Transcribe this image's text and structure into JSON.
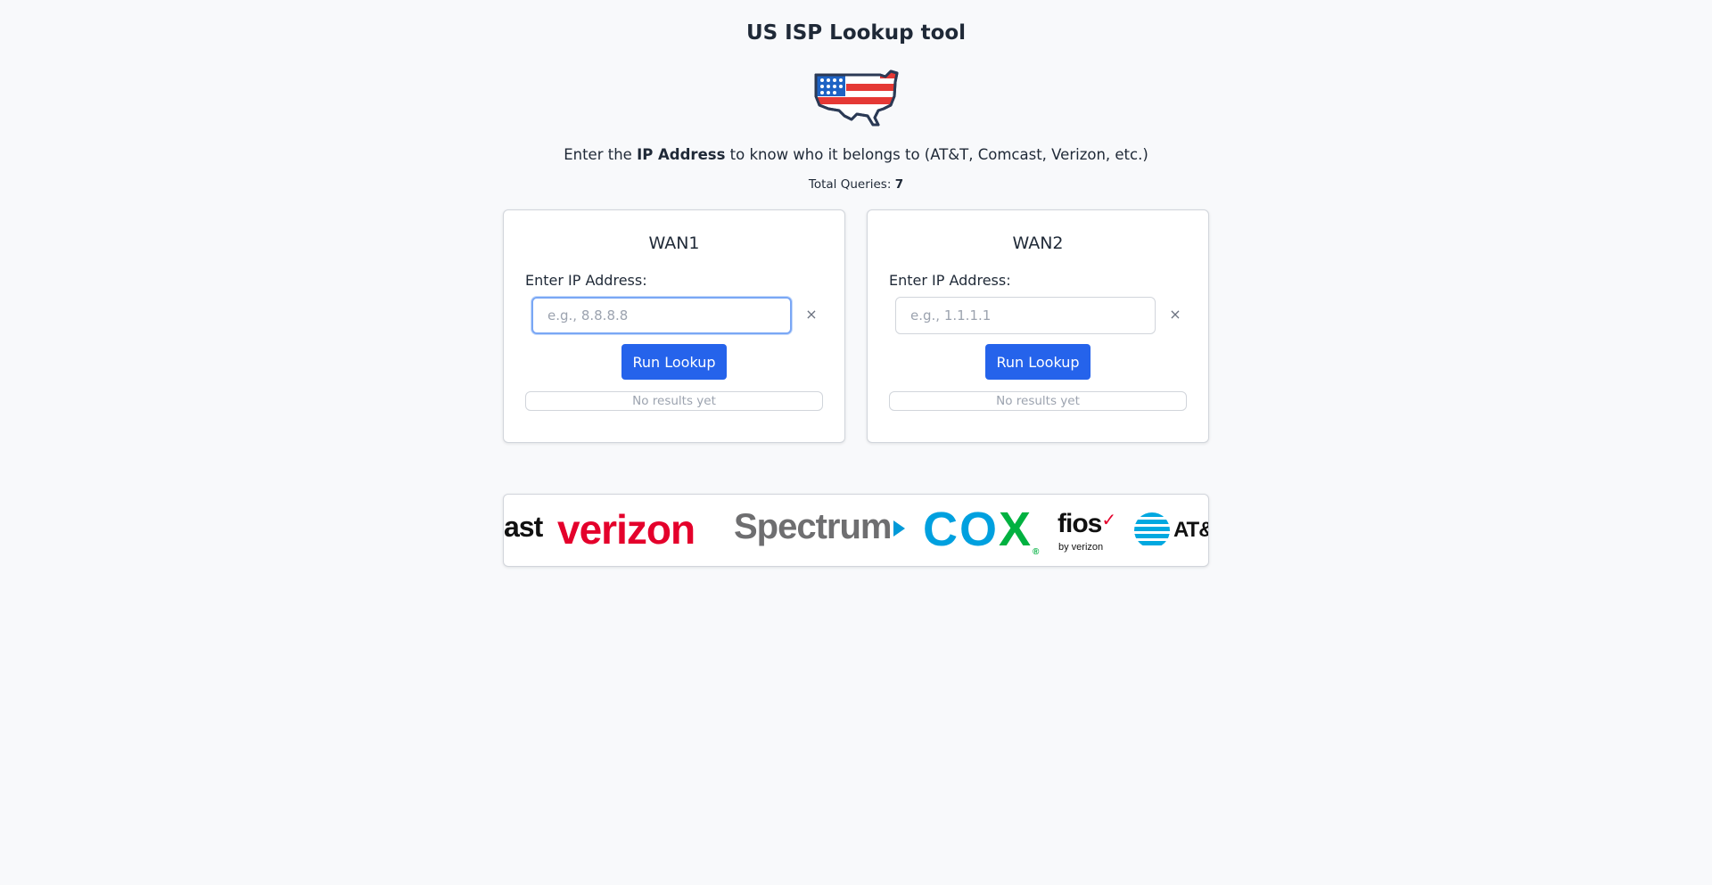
{
  "header": {
    "title": "US ISP Lookup tool",
    "intro_prefix": "Enter the ",
    "intro_bold": "IP Address",
    "intro_suffix": " to know who it belongs to (AT&T, Comcast, Verizon, etc.)",
    "queries_label": "Total Queries: ",
    "queries_count": "7"
  },
  "wan1": {
    "title": "WAN1",
    "label": "Enter IP Address:",
    "placeholder": "e.g., 8.8.8.8",
    "value": "",
    "focused": true,
    "clear_label": "×",
    "button_label": "Run Lookup",
    "results_text": "No results yet"
  },
  "wan2": {
    "title": "WAN2",
    "label": "Enter IP Address:",
    "placeholder": "e.g., 1.1.1.1",
    "value": "",
    "focused": false,
    "clear_label": "×",
    "button_label": "Run Lookup",
    "results_text": "No results yet"
  },
  "logos": {
    "comcast": "ast",
    "verizon": "verizon",
    "spectrum": "Spectrum",
    "cox_c": "C",
    "cox_o": "O",
    "cox_x": "X",
    "cox_reg": "®",
    "fios": "fios",
    "fios_check": "✓",
    "fios_by": "by verizon",
    "att": "AT&"
  },
  "colors": {
    "accent": "#2563eb",
    "flag_red": "#e53935",
    "flag_blue": "#1e63c4",
    "verizon_red": "#e4002b",
    "cox_blue": "#00a0df",
    "cox_green": "#00b140"
  }
}
